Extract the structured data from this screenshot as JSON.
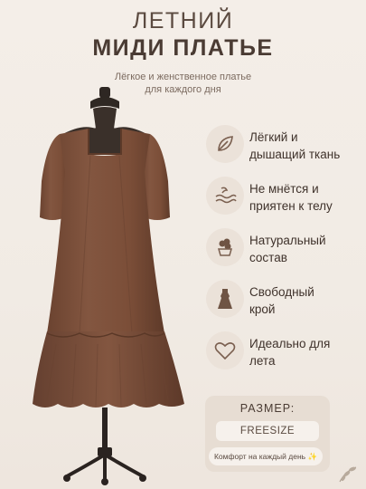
{
  "header": {
    "title_line1": "ЛЕТНИЙ",
    "title_line2": "МИДИ ПЛАТЬЕ",
    "subtitle_line1": "Лёгкое и женственное платье",
    "subtitle_line2": "для каждого дня"
  },
  "features": [
    {
      "icon": "leaf-icon",
      "line1": "Лёгкий и",
      "line2": "дышащий ткань"
    },
    {
      "icon": "wave-feather-icon",
      "line1": "Не мнётся и",
      "line2": "приятен к телу"
    },
    {
      "icon": "cotton-plant-icon",
      "line1": "Натуральный",
      "line2": "состав"
    },
    {
      "icon": "dress-icon",
      "line1": "Свободный",
      "line2": "крой"
    },
    {
      "icon": "heart-icon",
      "line1": "Идеально для",
      "line2": "лета"
    }
  ],
  "size": {
    "label": "РАЗМЕР:",
    "value": "FREESIZE",
    "comfort": "Комфорт на каждый день ✨"
  },
  "colors": {
    "dress": "#7b5038",
    "accent": "#8a6a56",
    "background": "#f2ece5"
  }
}
